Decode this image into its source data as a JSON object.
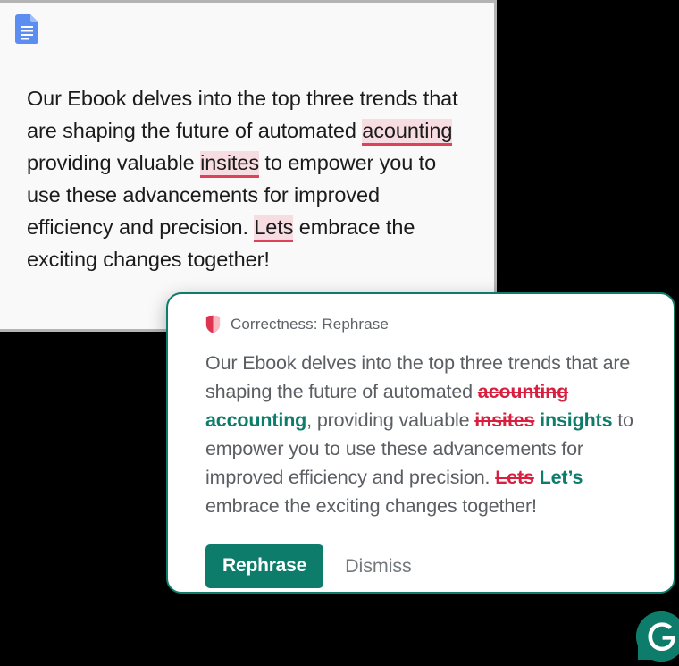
{
  "theme": {
    "page_background": "#000000",
    "accent_green": "#0e7c6b",
    "error_red": "#d81f3f",
    "error_highlight": "#f7dde1",
    "error_underline": "#e0415a",
    "doc_surface": "#f9f9f9"
  },
  "document": {
    "toolbar": {
      "icon": "google-docs-file-icon",
      "icon_color": "#5b8ef0"
    },
    "paragraph": {
      "segment_1": "Our Ebook delves into the top three trends that are shaping the future of automated ",
      "error_1": "acounting",
      "segment_2": " providing valuable ",
      "error_2": "insites",
      "segment_3": " to empower you to use these advancements for improved efficiency and precision. ",
      "error_3": "Lets",
      "segment_4": " embrace the exciting changes together!"
    }
  },
  "suggestion_card": {
    "icon": "shield-icon",
    "category_label": "Correctness: Rephrase",
    "preview": {
      "segment_1": "Our Ebook delves into the top three trends that are shaping the future of automated ",
      "deletion_1": "acounting",
      "insertion_1": "accounting",
      "segment_2": ", providing valuable ",
      "deletion_2": "insites",
      "insertion_2": "insights",
      "segment_3": " to empower you to use these advancements for improved efficiency and precision. ",
      "deletion_3": "Lets",
      "insertion_3": "Let’s",
      "segment_4": " embrace the exciting changes together!"
    },
    "actions": {
      "primary_label": "Rephrase",
      "secondary_label": "Dismiss"
    }
  },
  "branding": {
    "logo": "grammarly-g-logo",
    "logo_letter": "G"
  }
}
